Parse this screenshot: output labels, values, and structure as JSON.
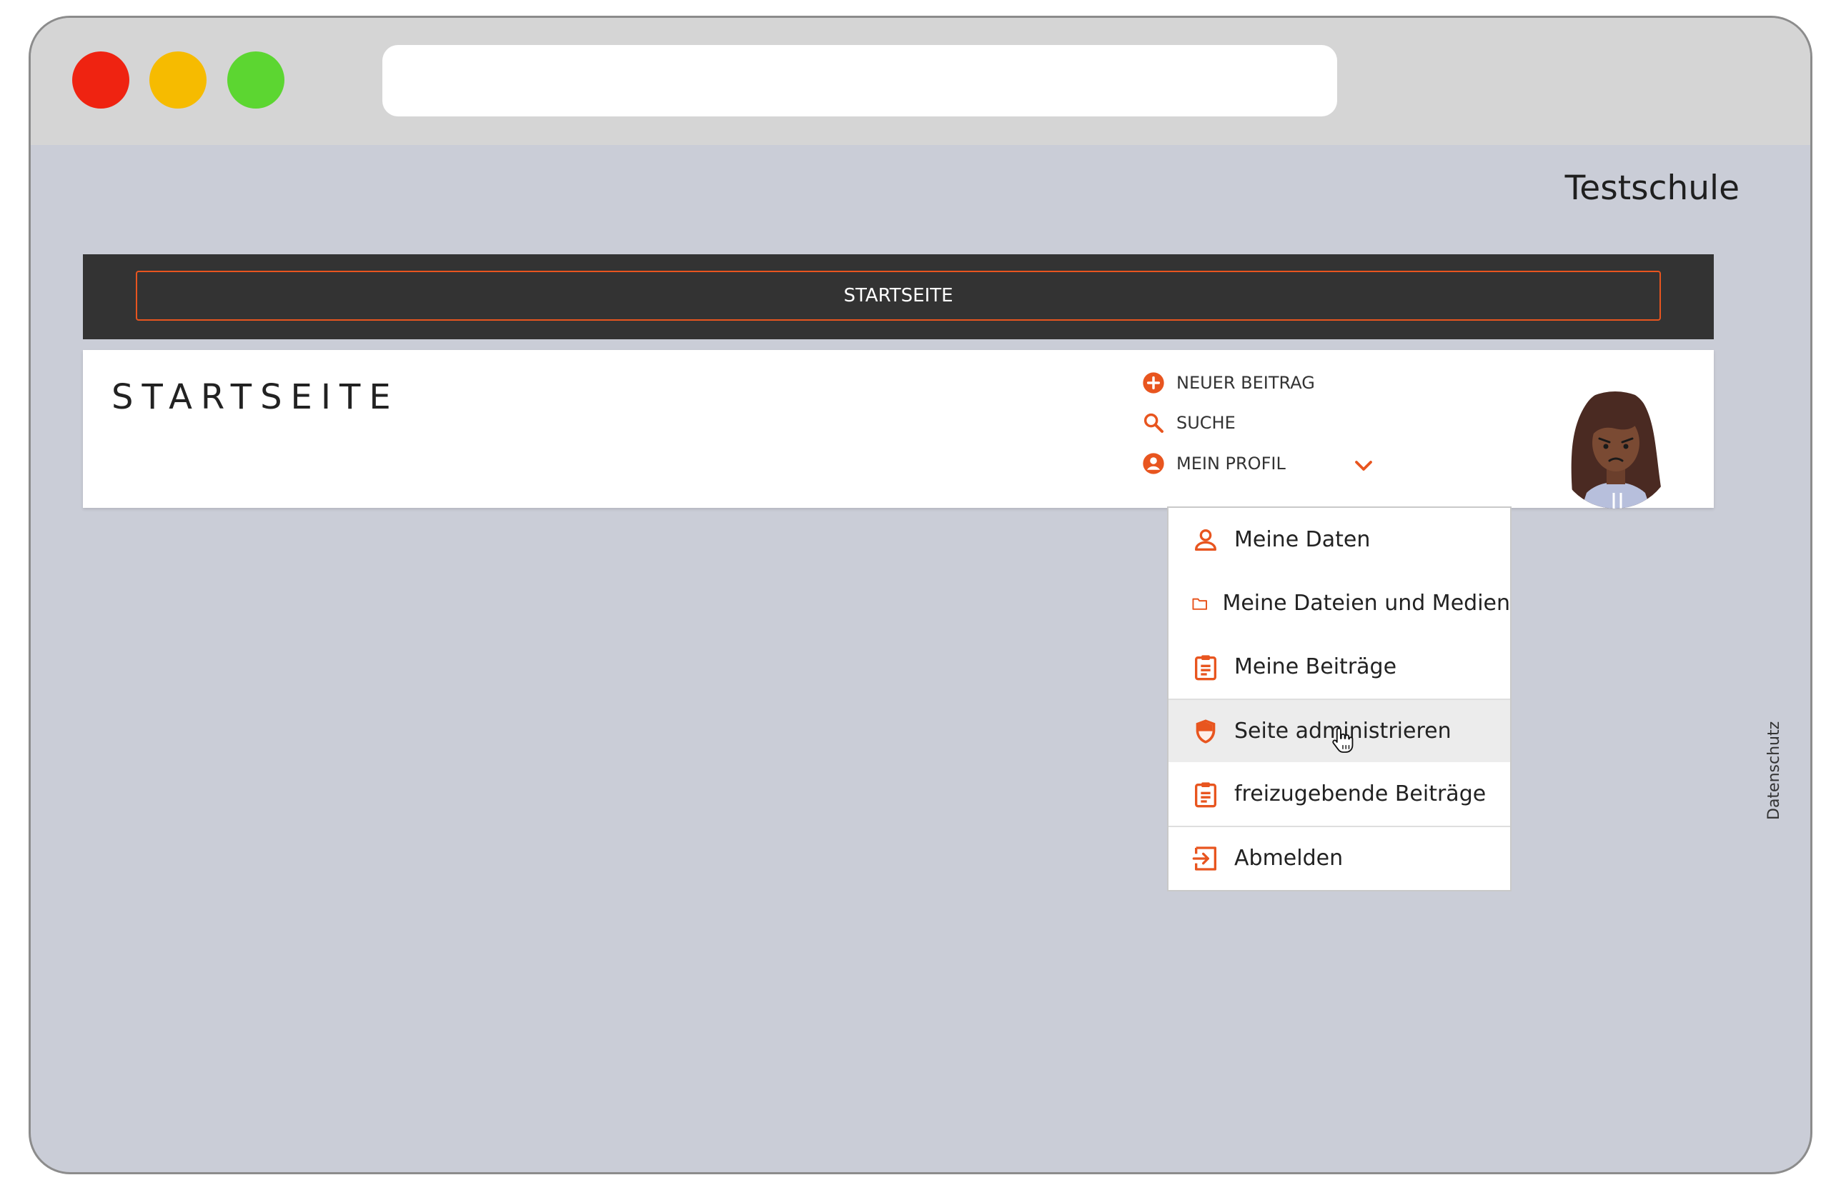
{
  "window": {
    "controls": [
      "close",
      "minimize",
      "maximize"
    ],
    "url": ""
  },
  "site": {
    "title": "Testschule"
  },
  "nav": {
    "items": [
      {
        "label": "STARTSEITE"
      }
    ]
  },
  "header": {
    "page_title": "STARTSEITE",
    "actions": {
      "new_post": {
        "label": "NEUER BEITRAG",
        "icon": "plus-circle-icon"
      },
      "search": {
        "label": "SUCHE",
        "icon": "search-icon"
      },
      "profile": {
        "label": "MEIN PROFIL",
        "icon": "account-circle-icon"
      }
    },
    "avatar_icon": "user-avatar"
  },
  "profile_menu": {
    "items": [
      {
        "label": "Meine Daten",
        "icon": "person-icon"
      },
      {
        "label": "Meine Dateien und Medien",
        "icon": "folder-icon"
      },
      {
        "label": "Meine Beiträge",
        "icon": "clipboard-icon"
      },
      {
        "label": "Seite administrieren",
        "icon": "shield-icon"
      },
      {
        "label": "freizugebende Beiträge",
        "icon": "clipboard-icon"
      },
      {
        "label": "Abmelden",
        "icon": "logout-icon"
      }
    ],
    "hovered_index": 3
  },
  "footer": {
    "privacy_label": "Datenschutz"
  },
  "colors": {
    "accent": "#e8551f",
    "navbar_bg": "#333333",
    "page_bg": "#cacdd7",
    "hover_bg": "#ececec"
  }
}
